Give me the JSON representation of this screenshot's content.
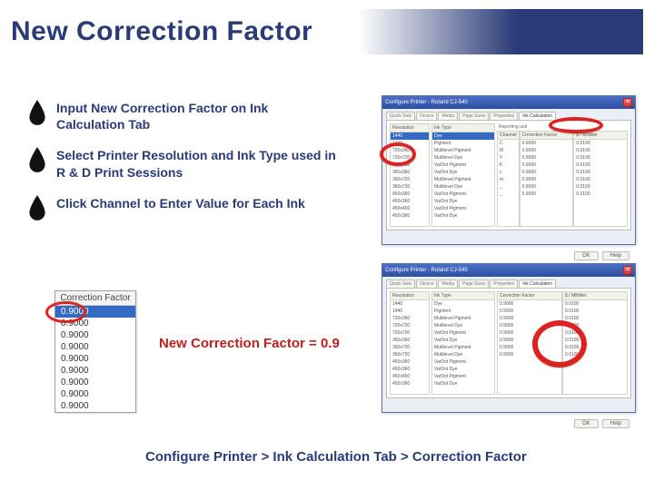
{
  "title": "New Correction Factor",
  "bullets": [
    "Input New Correction Factor on Ink Calculation Tab",
    "Select Printer Resolution and Ink Type used in R & D Print Sessions",
    "Click Channel to Enter Value for Each Ink"
  ],
  "cf_panel": {
    "header": "Correction Factor",
    "selected_value": "0.9000",
    "rows": [
      "0.9000",
      "0.9000",
      "0.9000",
      "0.9000",
      "0.9000",
      "0.9000",
      "0.9000",
      "0.9000",
      "0.9000"
    ]
  },
  "equation": "New Correction Factor = 0.9",
  "breadcrumb": "Configure Printer > Ink Calculation Tab > Correction Factor",
  "dialog": {
    "title": "Configure Printer - Roland CJ-540",
    "close": "×",
    "tabs": [
      "Quick Sets",
      "Device",
      "Media",
      "Page Sizes",
      "Properties",
      "Ink Calculation"
    ],
    "active_tab": 5,
    "columns": {
      "resolution_header": "Resolution",
      "resolutions": [
        "1440",
        "1440",
        "720x360",
        "720x720",
        "720x720",
        "360x360",
        "360x720",
        "360x720",
        "450x360",
        "450x360",
        "450x450",
        "450x360"
      ],
      "inktype_header": "Ink Type",
      "inktypes": [
        "Dye",
        "Pigment",
        "Multilevel Pigment",
        "Multilevel Dye",
        "VarDot Pigment",
        "VarDot Dye",
        "Multilevel Pigment",
        "Multilevel Dye",
        "VarDot Pigment",
        "VarDot Dye",
        "VarDot Pigment",
        "VarDot Dye"
      ],
      "reporting_unit": "Reporting unit",
      "channel_header": "Channel",
      "channels": [
        "C",
        "M",
        "Y",
        "K",
        "c",
        "m",
        "_",
        "_"
      ],
      "cf_header": "Correction Factor",
      "cf_values": [
        "0.9000",
        "0.9000",
        "0.9000",
        "0.9000",
        "0.9000",
        "0.9000",
        "0.9000",
        "0.9000"
      ],
      "unit_header": "$ / Milliliter",
      "unit_values": [
        "0.0100",
        "0.0100",
        "0.0100",
        "0.0100",
        "0.0100",
        "0.0100",
        "0.0100",
        "0.0100"
      ]
    },
    "buttons": {
      "ok": "OK",
      "help": "Help"
    }
  }
}
